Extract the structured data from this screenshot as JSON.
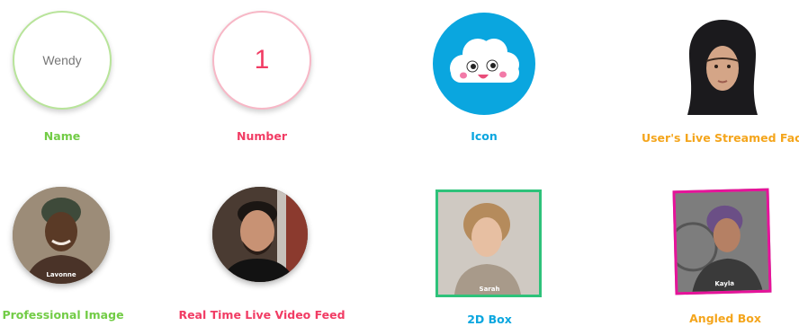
{
  "colors": {
    "green": "#72cc46",
    "red": "#f13c64",
    "blue": "#0aa6df",
    "orange": "#f4a51c",
    "magenta": "#e6139a"
  },
  "name_badge": {
    "text": "Wendy",
    "label": "Name"
  },
  "number_badge": {
    "text": "1",
    "label": "Number"
  },
  "icon_badge": {
    "icon": "smiling-cloud-icon",
    "label": "Icon"
  },
  "face_badge": {
    "label": "User's Live Streamed Face"
  },
  "professional_badge": {
    "caption": "Lavonne",
    "label": "Professional Image"
  },
  "video_badge": {
    "label": "Real Time Live Video Feed"
  },
  "box2d_badge": {
    "caption": "Sarah",
    "label": "2D Box"
  },
  "angled_badge": {
    "caption": "Kayla",
    "label": "Angled Box"
  }
}
